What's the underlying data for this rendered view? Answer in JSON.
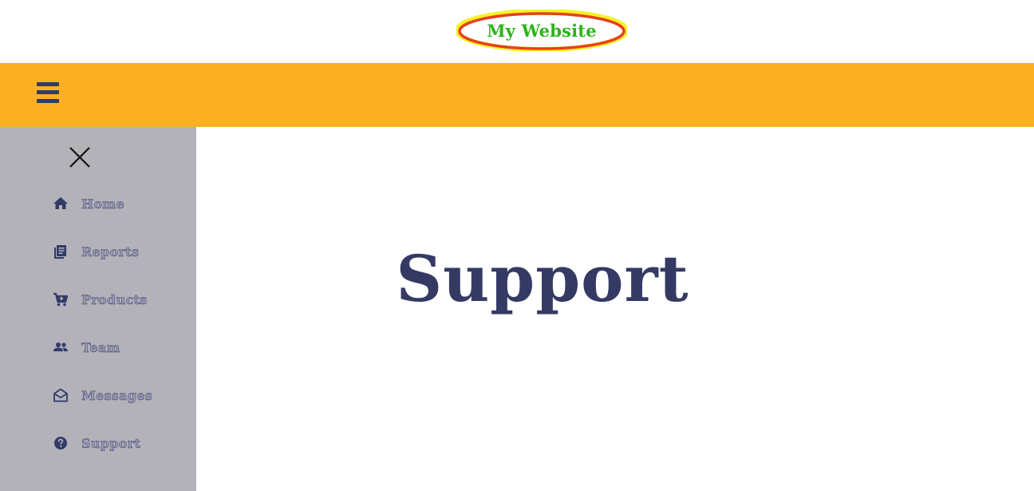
{
  "header": {
    "site_title": "My Website"
  },
  "navbar": {
    "menu_icon": "hamburger-menu-icon"
  },
  "sidebar": {
    "close_icon": "close-icon",
    "items": [
      {
        "label": "Home",
        "icon": "home-icon"
      },
      {
        "label": "Reports",
        "icon": "reports-icon"
      },
      {
        "label": "Products",
        "icon": "cart-icon"
      },
      {
        "label": "Team",
        "icon": "team-icon"
      },
      {
        "label": "Messages",
        "icon": "envelope-open-icon"
      },
      {
        "label": "Support",
        "icon": "help-circle-icon"
      }
    ]
  },
  "main": {
    "heading": "Support"
  },
  "colors": {
    "navbar": "#fab020",
    "sidebar": "#b3b2b9",
    "heading": "#343a63",
    "logo_text": "#2db31a",
    "logo_ring": "#e8401c",
    "logo_glow": "#f5f000"
  }
}
